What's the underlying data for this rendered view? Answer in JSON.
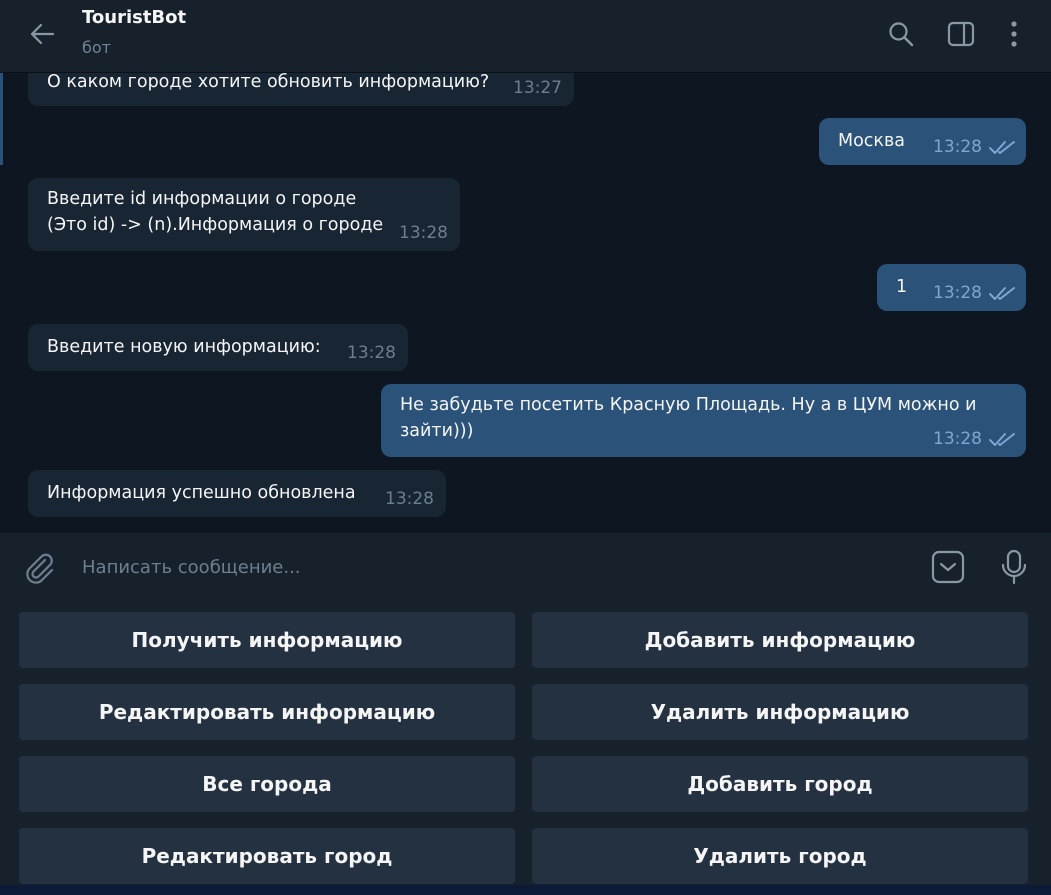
{
  "header": {
    "title": "TouristBot",
    "subtitle": "бот"
  },
  "messages": [
    {
      "direction": "in",
      "text": "О каком городе хотите обновить информацию?",
      "time": "13:27"
    },
    {
      "direction": "out",
      "text": "Москва",
      "time": "13:28",
      "status": "read"
    },
    {
      "direction": "in",
      "text": "Введите id информации о городе\n(Это id) -> (n).Информация о городе",
      "time": "13:28"
    },
    {
      "direction": "out",
      "text": "1",
      "time": "13:28",
      "status": "read"
    },
    {
      "direction": "in",
      "text": "Введите новую информацию:",
      "time": "13:28"
    },
    {
      "direction": "out",
      "text": "Не забудьте посетить Красную Площадь. Ну а в ЦУМ можно и\nзайти)))",
      "time": "13:28",
      "status": "read"
    },
    {
      "direction": "in",
      "text": "Информация успешно обновлена",
      "time": "13:28"
    }
  ],
  "composer": {
    "placeholder": "Написать сообщение..."
  },
  "keyboard": {
    "buttons": [
      "Получить информацию",
      "Добавить информацию",
      "Редактировать информацию",
      "Удалить информацию",
      "Все города",
      "Добавить город",
      "Редактировать город",
      "Удалить город"
    ]
  },
  "icons": [
    "back-arrow-icon",
    "search-icon",
    "sidebar-toggle-icon",
    "more-vertical-icon",
    "paperclip-icon",
    "keyboard-icon",
    "microphone-icon",
    "double-check-icon"
  ],
  "colors": {
    "background": "#0e1621",
    "panel": "#17212b",
    "incoming_bubble": "#182533",
    "outgoing_bubble": "#2b5278",
    "keyboard_button": "#243140",
    "muted_text": "#708499",
    "read_check": "#7da8d3"
  }
}
